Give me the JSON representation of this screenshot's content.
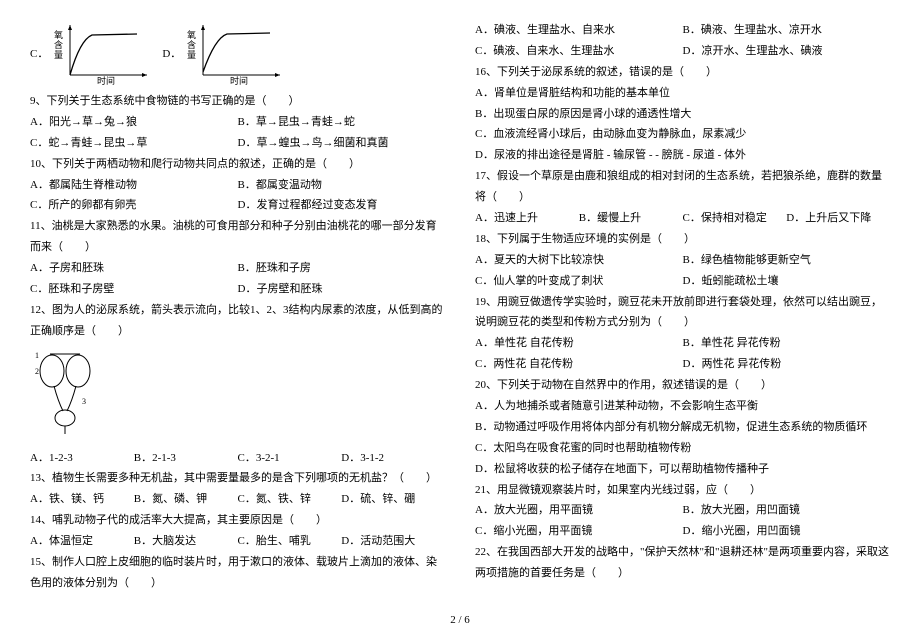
{
  "charts": {
    "c_label": "C．",
    "d_label": "D．",
    "y_axis": "氧含量",
    "x_axis": "时间"
  },
  "left": {
    "q9": "9、下列关于生态系统中食物链的书写正确的是（　　）",
    "q9a": "A．阳光→草→兔→狼",
    "q9b": "B．草→昆虫→青蛙→蛇",
    "q9c": "C．蛇→青蛙→昆虫→草",
    "q9d": "D．草→蝗虫→鸟→细菌和真菌",
    "q10": "10、下列关于两栖动物和爬行动物共同点的叙述，正确的是（　　）",
    "q10a": "A．都属陆生脊椎动物",
    "q10b": "B．都属变温动物",
    "q10c": "C．所产的卵都有卵壳",
    "q10d": "D．发育过程都经过变态发育",
    "q11": "11、油桃是大家熟悉的水果。油桃的可食用部分和种子分别由油桃花的哪一部分发育而来（　　）",
    "q11a": "A．子房和胚珠",
    "q11b": "B．胚珠和子房",
    "q11c": "C．胚珠和子房壁",
    "q11d": "D．子房壁和胚珠",
    "q12": "12、图为人的泌尿系统，箭头表示流向，比较1、2、3结构内尿素的浓度，从低到高的正确顺序是（　　）",
    "q12a": "A．1-2-3",
    "q12b": "B．2-1-3",
    "q12c": "C．3-2-1",
    "q12d": "D．3-1-2",
    "q13": "13、植物生长需要多种无机盐，其中需要量最多的是含下列哪项的无机盐？（　　）",
    "q13a": "A．铁、镁、钙",
    "q13b": "B．氮、磷、钾",
    "q13c": "C．氮、铁、锌",
    "q13d": "D．硫、锌、硼",
    "q14": "14、哺乳动物子代的成活率大大提高，其主要原因是（　　）",
    "q14a": "A．体温恒定",
    "q14b": "B．大脑发达",
    "q14c": "C．胎生、哺乳",
    "q14d": "D．活动范围大",
    "q15": "15、制作人口腔上皮细胞的临时装片时，用于漱口的液体、载玻片上滴加的液体、染色用的液体分别为（　　）"
  },
  "right": {
    "q15a": "A．碘液、生理盐水、自来水",
    "q15b": "B．碘液、生理盐水、凉开水",
    "q15c": "C．碘液、自来水、生理盐水",
    "q15d": "D．凉开水、生理盐水、碘液",
    "q16": "16、下列关于泌尿系统的叙述，错误的是（　　）",
    "q16a": "A．肾单位是肾脏结构和功能的基本单位",
    "q16b": "B．出现蛋白尿的原因是肾小球的通透性增大",
    "q16c": "C．血液流经肾小球后，由动脉血变为静脉血，尿素减少",
    "q16d": "D．尿液的排出途径是肾脏 - 输尿管 - - 膀胱 - 尿道 - 体外",
    "q17": "17、假设一个草原是由鹿和狼组成的相对封闭的生态系统，若把狼杀绝，鹿群的数量将（　　）",
    "q17a": "A．迅速上升",
    "q17b": "B．缓慢上升",
    "q17c": "C．保持相对稳定",
    "q17d": "D．上升后又下降",
    "q18": "18、下列属于生物适应环境的实例是（　　）",
    "q18a": "A．夏天的大树下比较凉快",
    "q18b": "B．绿色植物能够更新空气",
    "q18c": "C．仙人掌的叶变成了刺状",
    "q18d": "D．蚯蚓能疏松土壤",
    "q19": "19、用豌豆做遗传学实验时，豌豆花未开放前即进行套袋处理，依然可以结出豌豆，说明豌豆花的类型和传粉方式分别为（　　）",
    "q19a": "A．单性花  自花传粉",
    "q19b": "B．单性花  异花传粉",
    "q19c": "C．两性花  自花传粉",
    "q19d": "D．两性花  异花传粉",
    "q20": "20、下列关于动物在自然界中的作用，叙述错误的是（　　）",
    "q20a": "A．人为地捕杀或者随意引进某种动物，不会影响生态平衡",
    "q20b": "B．动物通过呼吸作用将体内部分有机物分解成无机物，促进生态系统的物质循环",
    "q20c": "C．太阳鸟在吸食花蜜的同时也帮助植物传粉",
    "q20d": "D．松鼠将收获的松子储存在地面下，可以帮助植物传播种子",
    "q21": "21、用显微镜观察装片时，如果室内光线过弱，应（　　）",
    "q21a": "A．放大光圈，用平面镜",
    "q21b": "B．放大光圈，用凹面镜",
    "q21c": "C．缩小光圈，用平面镜",
    "q21d": "D．缩小光圈，用凹面镜",
    "q22": "22、在我国西部大开发的战略中，\"保护天然林\"和\"退耕还林\"是两项重要内容，采取这两项措施的首要任务是（　　）"
  },
  "pagenum": "2 / 6"
}
